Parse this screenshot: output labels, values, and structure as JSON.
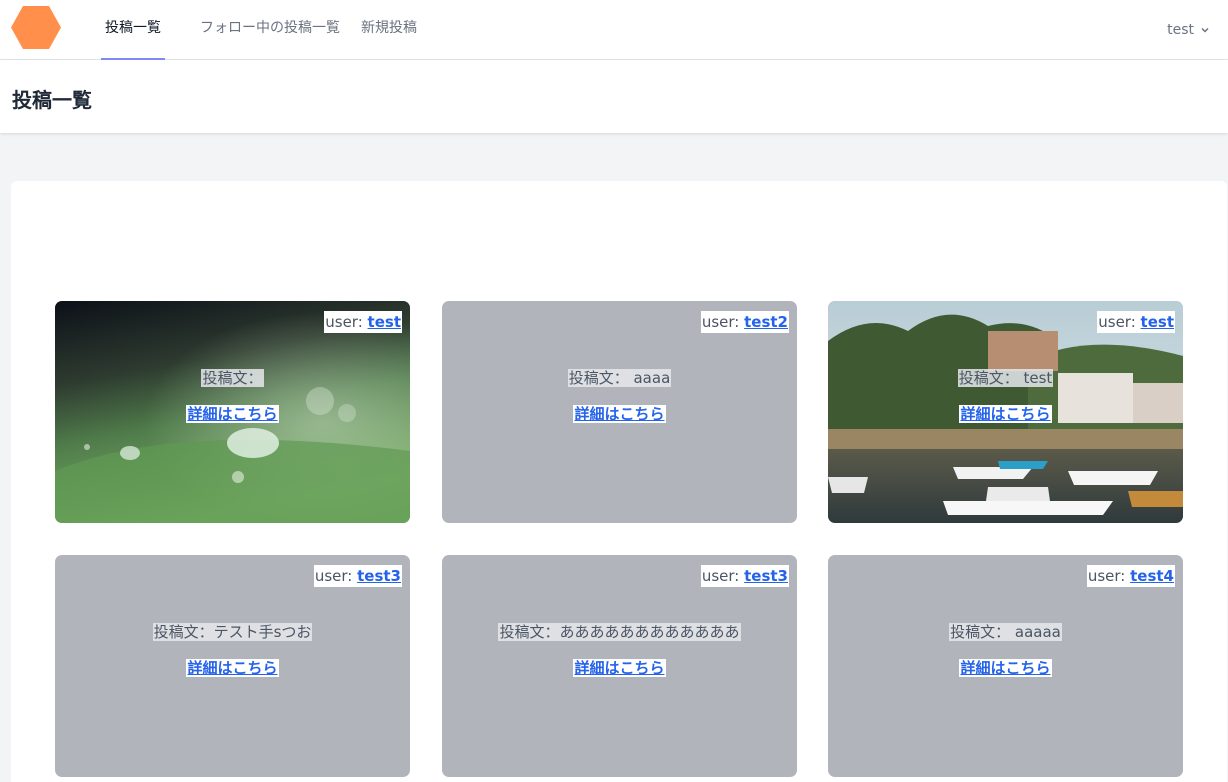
{
  "nav": {
    "links": [
      "投稿一覧",
      "フォロー中の投稿一覧",
      "新規投稿"
    ],
    "user_label": "test"
  },
  "header": {
    "title": "投稿一覧"
  },
  "posts": [
    {
      "user_prefix": "user:",
      "user": "test",
      "text": "投稿文：",
      "link": "詳細はこちら",
      "image": "water-droplet-photo"
    },
    {
      "user_prefix": "user:",
      "user": "test2",
      "text": "投稿文： aaaa",
      "link": "詳細はこちら",
      "image": ""
    },
    {
      "user_prefix": "user:",
      "user": "test",
      "text": "投稿文： test",
      "link": "詳細はこちら",
      "image": "harbor-photo"
    },
    {
      "user_prefix": "user:",
      "user": "test3",
      "text": "投稿文：テスト手sつお",
      "link": "詳細はこちら",
      "image": ""
    },
    {
      "user_prefix": "user:",
      "user": "test3",
      "text": "投稿文：ああああああああああああ",
      "link": "詳細はこちら",
      "image": ""
    },
    {
      "user_prefix": "user:",
      "user": "test4",
      "text": "投稿文： aaaaa",
      "link": "詳細はこちら",
      "image": ""
    }
  ],
  "colors": {
    "logo": "#ff8f4a",
    "active_underline": "#818cf8",
    "link": "#2563eb",
    "card_placeholder": "#b2b4bc",
    "page_bg": "#f3f4f6"
  }
}
